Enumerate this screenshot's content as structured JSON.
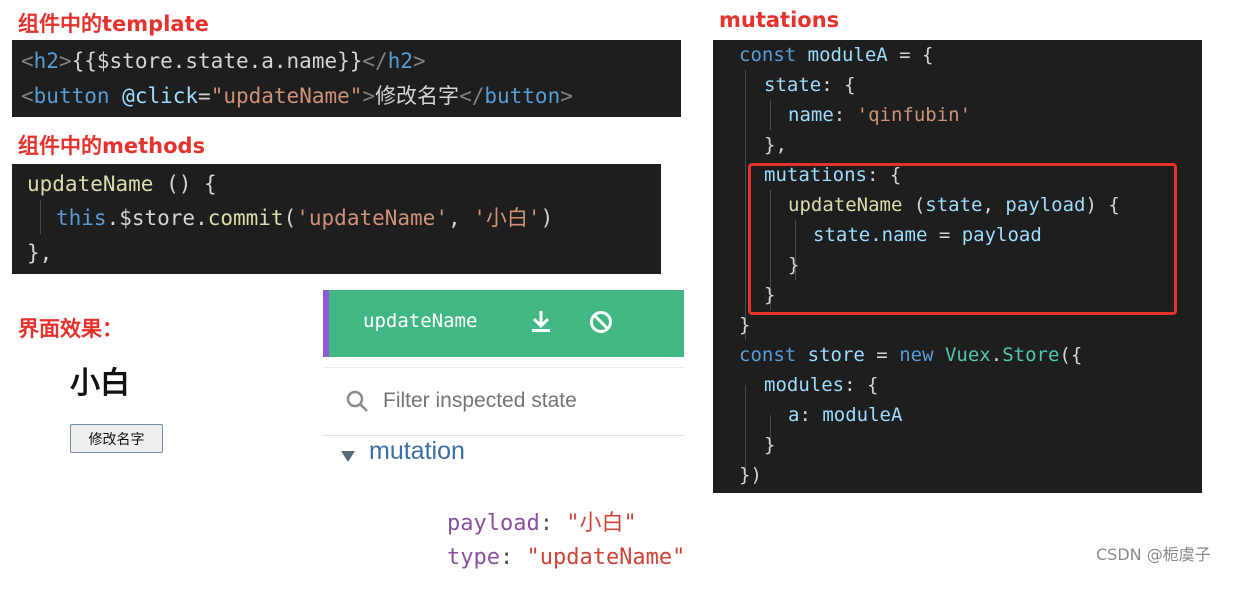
{
  "labels": {
    "template_heading": "组件中的template",
    "methods_heading": "组件中的methods",
    "result_heading": "界面效果：",
    "mutations_heading": "mutations"
  },
  "template_code": {
    "line1": {
      "open_tag": "h2",
      "mustache": "{{$store.state.a.name}}",
      "close_tag": "h2"
    },
    "line2": {
      "tag": "button",
      "attr": "@click",
      "attr_value": "\"updateName\"",
      "text": "修改名字",
      "close_tag": "button"
    }
  },
  "methods_code": {
    "line1": {
      "name": "updateName",
      "rest": " () {"
    },
    "line2": {
      "this": "this",
      "store": ".$store.",
      "commit": "commit",
      "open": "(",
      "arg1": "'updateName'",
      "sep": ", ",
      "arg2": "'小白'",
      "close": ")"
    },
    "line3": "},"
  },
  "preview": {
    "heading": "小白",
    "button_label": "修改名字"
  },
  "devtools": {
    "mutation_name": "updateName",
    "filter_placeholder": "Filter inspected state",
    "section_title": "mutation",
    "fields": [
      {
        "key": "payload",
        "value": "\"小白\""
      },
      {
        "key": "type",
        "value": "\"updateName\""
      }
    ],
    "icons": [
      "download-icon",
      "block-icon",
      "search-icon",
      "triangle-down-icon"
    ],
    "accent_color": "#41b883"
  },
  "mutations_code": {
    "l1": {
      "kw": "const",
      "name": "moduleA",
      "rest": " = {"
    },
    "l2": {
      "key": "state",
      "rest": ": {"
    },
    "l3": {
      "key": "name",
      "sep": ": ",
      "val": "'qinfubin'"
    },
    "l4": "},",
    "l5": {
      "key": "mutations",
      "rest": ": {"
    },
    "l6": {
      "fn": "updateName",
      "open": " (",
      "p1": "state",
      "sep": ", ",
      "p2": "payload",
      "close": ") {"
    },
    "l7": {
      "obj": "state",
      "prop": ".name",
      "eq": " = ",
      "val": "payload"
    },
    "l8": "}",
    "l9": "}",
    "l10": "}",
    "l11": {
      "kw": "const",
      "name": "store",
      "eq": " = ",
      "new": "new",
      "cls": "Vuex",
      "dot": ".",
      "ctor": "Store",
      "rest": "({"
    },
    "l12": {
      "key": "modules",
      "rest": ": {"
    },
    "l13": {
      "key": "a",
      "sep": ": ",
      "val": "moduleA"
    },
    "l14": "}",
    "l15": "})"
  },
  "watermark": "CSDN @栀虞子"
}
